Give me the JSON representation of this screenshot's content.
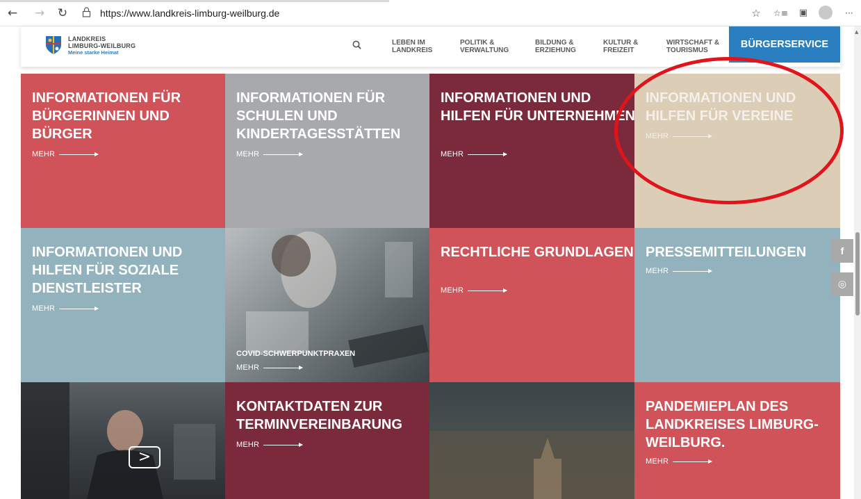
{
  "browser": {
    "url": "https://www.landkreis-limburg-weilburg.de",
    "back_icon": "←",
    "forward_icon": "→",
    "reload_icon": "↻",
    "lock_icon": "🔒",
    "favorite_icon": "☆",
    "favorites_bar_icon": "☆≡",
    "collections_icon": "▣",
    "more_icon": "···"
  },
  "header": {
    "brand_line1": "LANDKREIS",
    "brand_line2": "LIMBURG-WEILBURG",
    "brand_tagline": "Meine starke Heimat",
    "menu": [
      {
        "line1": "LEBEN IM",
        "line2": "LANDKREIS"
      },
      {
        "line1": "POLITIK &",
        "line2": "VERWALTUNG"
      },
      {
        "line1": "BILDUNG &",
        "line2": "ERZIEHUNG"
      },
      {
        "line1": "KULTUR &",
        "line2": "FREIZEIT"
      },
      {
        "line1": "WIRTSCHAFT &",
        "line2": "TOURISMUS"
      }
    ],
    "cta": "BÜRGERSERVICE"
  },
  "tiles": [
    {
      "title": "INFORMATIONEN FÜR BÜRGERINNEN UND BÜRGER",
      "more": "MEHR",
      "color": "#cf5358"
    },
    {
      "title": "INFORMATIONEN FÜR SCHULEN UND KINDERTAGESSTÄTTEN",
      "more": "MEHR",
      "color": "#a7a9ac"
    },
    {
      "title": "INFORMATIONEN UND HILFEN FÜR UNTERNEHMEN",
      "more": "MEHR",
      "color": "#7b2a3c"
    },
    {
      "title": "INFORMATIONEN UND HILFEN FÜR VEREINE",
      "more": "MEHR",
      "color": "#dccdb6"
    },
    {
      "title": "INFORMATIONEN UND HILFEN FÜR SOZIALE DIENSTLEISTER",
      "more": "MEHR",
      "color": "#92b3bd"
    },
    {
      "title": "COVID-SCHWERPUNKTPRAXEN",
      "more": "MEHR",
      "color": "#6b7478"
    },
    {
      "title": "RECHTLICHE GRUNDLAGEN",
      "more": "MEHR",
      "color": "#cf5358"
    },
    {
      "title": "PRESSEMITTEILUNGEN",
      "more": "MEHR",
      "color": "#92b3bd"
    },
    {
      "title": "",
      "more": "",
      "color": "#3e4347"
    },
    {
      "title": "KONTAKTDATEN ZUR TERMINVEREINBARUNG",
      "more": "MEHR",
      "color": "#7b2a3c"
    },
    {
      "title": "",
      "more": "",
      "color": "#4a4f4f"
    },
    {
      "title": "PANDEMIEPLAN DES LANDKREISES LIMBURG-WEILBURG.",
      "more": "MEHR",
      "color": "#cf5358"
    }
  ],
  "social": {
    "facebook": "f",
    "instagram": "◎"
  },
  "video": {
    "play_icon": ">"
  }
}
